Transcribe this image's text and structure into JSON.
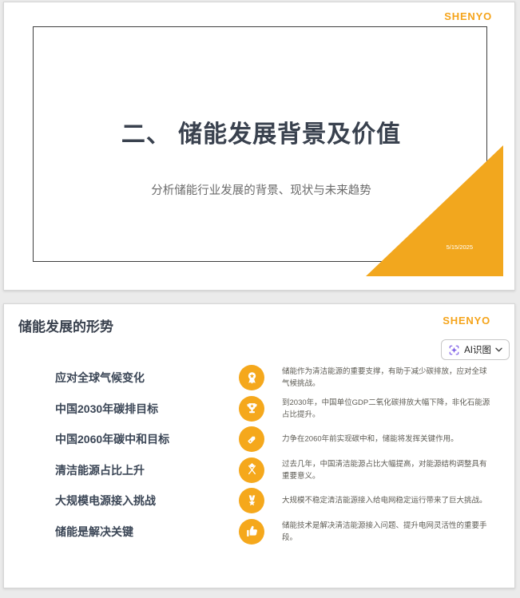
{
  "colors": {
    "accent_orange": "#F5A81C",
    "triangle_orange": "#F2A71E",
    "heading_dark": "#39414E",
    "desc_gray": "#5E5C55",
    "ai_purple": "#7B5BE6",
    "page_background": "#ebebeb"
  },
  "slide1": {
    "logo": "SHENYO",
    "title": "二、 储能发展背景及价值",
    "subtitle": "分析储能行业发展的背景、现状与未来趋势",
    "date": "5/15/2025"
  },
  "slide2": {
    "logo": "SHENYO",
    "heading": "储能发展的形势",
    "ai_button": {
      "label": "AI识图"
    },
    "items": [
      {
        "title": "应对全球气候变化",
        "icon": "award-ribbon-icon",
        "desc": "储能作为清洁能源的重要支撑，有助于减少碳排放，应对全球气候挑战。"
      },
      {
        "title": "中国2030年碳排目标",
        "icon": "trophy-icon",
        "desc": "到2030年，中国单位GDP二氧化碳排放大幅下降，非化石能源占比提升。"
      },
      {
        "title": "中国2060年碳中和目标",
        "icon": "tag-icon",
        "desc": "力争在2060年前实现碳中和，储能将发挥关键作用。"
      },
      {
        "title": "清洁能源占比上升",
        "icon": "crossed-flags-icon",
        "desc": "过去几年，中国清洁能源占比大幅提高，对能源结构调整具有重要意义。"
      },
      {
        "title": "大规模电源接入挑战",
        "icon": "medal-star-icon",
        "desc": "大规模不稳定清洁能源接入给电网稳定运行带来了巨大挑战。"
      },
      {
        "title": "储能是解决关键",
        "icon": "thumbs-up-icon",
        "desc": "储能技术是解决清洁能源接入问题、提升电网灵活性的重要手段。"
      }
    ]
  }
}
